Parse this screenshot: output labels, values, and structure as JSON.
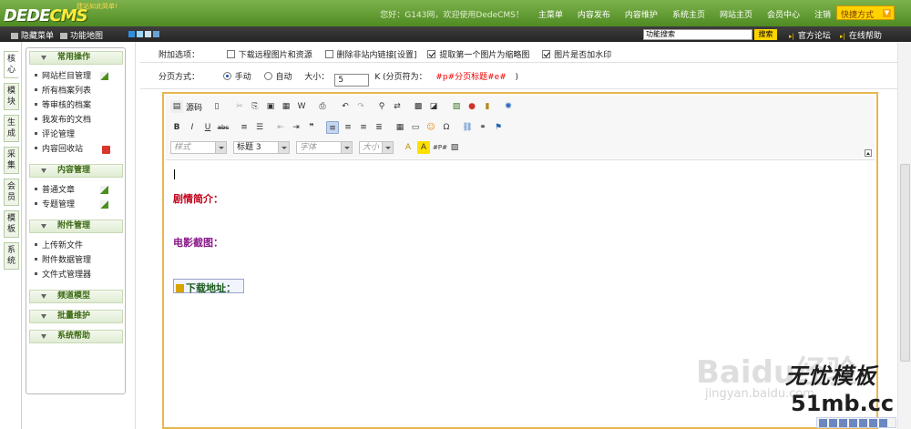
{
  "header": {
    "logo_text_1": "DEDE",
    "logo_text_2": "CMS",
    "slogan": "建站如此简单!",
    "greeting": "您好：G143网，欢迎使用DedeCMS！",
    "nav": [
      "主菜单",
      "内容发布",
      "内容维护",
      "系统主页",
      "网站主页",
      "会员中心",
      "注销"
    ],
    "quick_label": "快捷方式"
  },
  "subbar": {
    "hide_menu": "隐藏菜单",
    "site_map": "功能地图",
    "skin_colors": [
      "#2f8ee0",
      "#9dd6f7",
      "#cfe3f3",
      "#6aa3d4"
    ],
    "search_value": "功能搜索",
    "search_button": "搜索",
    "forum": "官方论坛",
    "help": "在线帮助"
  },
  "left_tabs": [
    "核心",
    "模块",
    "生成",
    "采集",
    "会员",
    "模板",
    "系统"
  ],
  "menu": {
    "sections": [
      {
        "title": "常用操作",
        "items": [
          "网站栏目管理",
          "所有档案列表",
          "等审核的档案",
          "我发布的文档",
          "评论管理",
          "内容回收站"
        ]
      },
      {
        "title": "内容管理",
        "items": [
          "普通文章",
          "专题管理"
        ]
      },
      {
        "title": "附件管理",
        "items": [
          "上传新文件",
          "附件数据管理",
          "文件式管理器"
        ]
      },
      {
        "title": "频道模型",
        "items": []
      },
      {
        "title": "批量维护",
        "items": []
      },
      {
        "title": "系统帮助",
        "items": []
      }
    ]
  },
  "form": {
    "extra_label": "附加选项：",
    "options": [
      {
        "label": "下载远程图片和资源",
        "checked": false
      },
      {
        "label": "删除非站内链接",
        "checked": false
      },
      {
        "label": "[设置]",
        "checked": null
      },
      {
        "label": "提取第一个图片为缩略图",
        "checked": true
      },
      {
        "label": "图片是否加水印",
        "checked": true
      }
    ],
    "paging_label": "分页方式：",
    "manual": "手动",
    "auto": "自动",
    "size_label": "大小：",
    "size_value": "5",
    "size_unit": "K (分页符为：",
    "page_marker": "#p#分页标题#e#",
    "page_marker_close": ")"
  },
  "editor": {
    "source_label": "源码",
    "style_placeholder": "样式",
    "format_value": "标题 3",
    "font_placeholder": "字体",
    "size_placeholder": "大小",
    "headings": [
      {
        "text": "剧情简介：",
        "color": "#c0001a"
      },
      {
        "text": "电影截图：",
        "color": "#8a1a8a"
      },
      {
        "text": "下载地址：",
        "color": "#1a5a1a"
      }
    ]
  },
  "watermark": {
    "baidu": "Baidu经验",
    "url": "jingyan.baidu.com",
    "brand": "无忧模板",
    "brand_url": "51mb.cc"
  }
}
